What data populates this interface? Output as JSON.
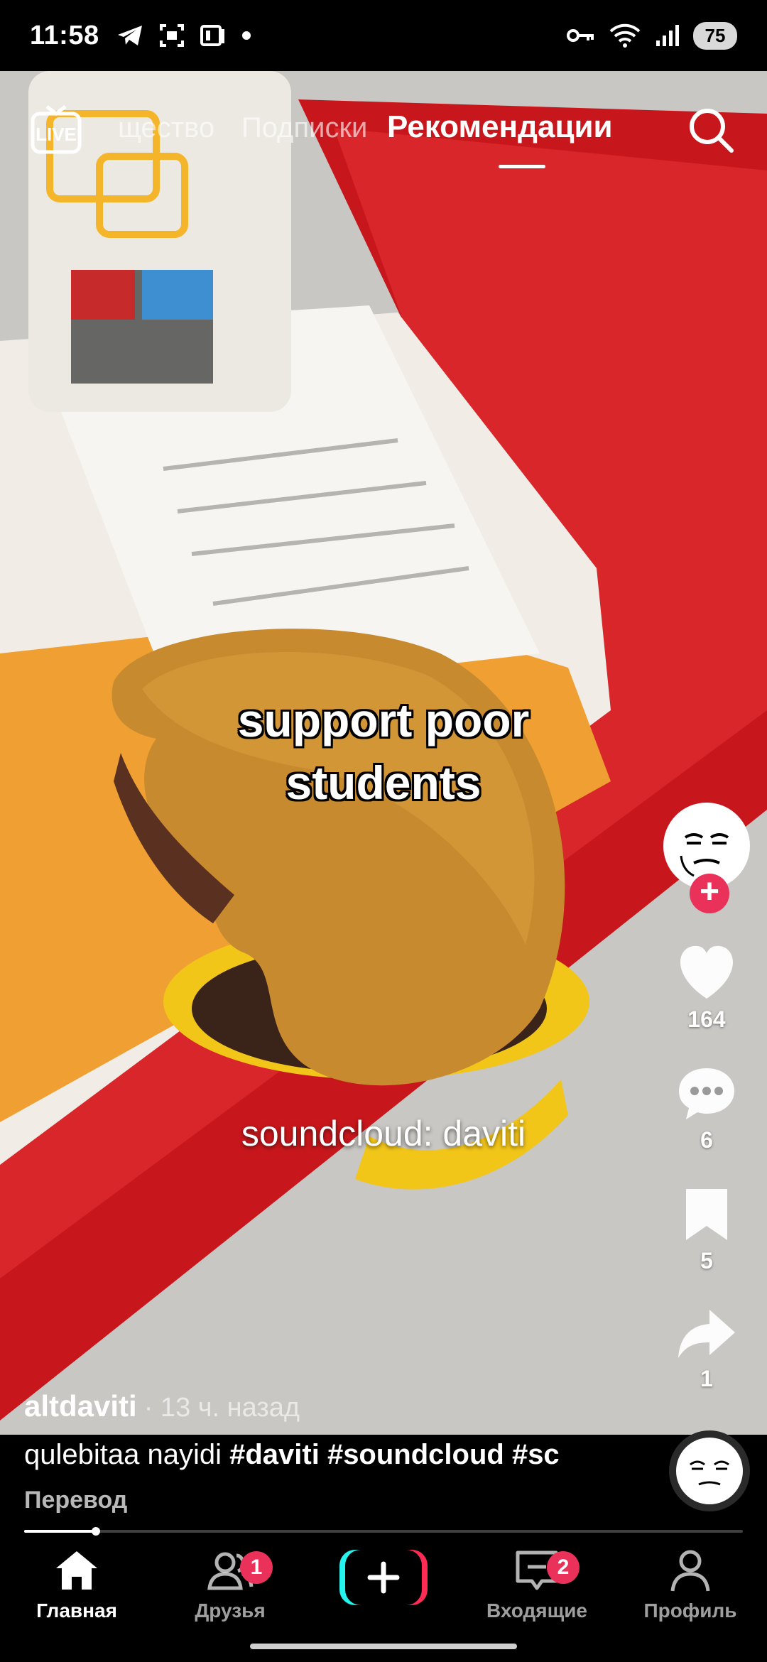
{
  "status_bar": {
    "time": "11:58",
    "battery": "75",
    "icons": [
      "telegram-icon",
      "screenshot-icon",
      "media-icon",
      "dot-icon",
      "key-icon",
      "wifi-icon",
      "signal-icon"
    ]
  },
  "top_nav": {
    "live_label": "LIVE",
    "tabs": [
      {
        "label": "щество",
        "active": false
      },
      {
        "label": "Подписки",
        "active": false
      },
      {
        "label": "Рекомендации",
        "active": true
      }
    ]
  },
  "video": {
    "caption_main_line1": "support poor",
    "caption_main_line2": "students",
    "caption_secondary": "soundcloud: daviti"
  },
  "actions": {
    "likes": "164",
    "comments": "6",
    "saves": "5",
    "shares": "1"
  },
  "post": {
    "author": "altdaviti",
    "time_ago": "· 13 ч. назад",
    "description_text": "qulebitaa nayidi ",
    "description_tags": "#daviti #soundcloud #sc",
    "translate_label": "Перевод",
    "progress": 0.1
  },
  "bottom_nav": {
    "items": [
      {
        "label": "Главная",
        "active": true
      },
      {
        "label": "Друзья",
        "badge": "1"
      },
      {
        "label": "",
        "create": true
      },
      {
        "label": "Входящие",
        "badge": "2"
      },
      {
        "label": "Профиль"
      }
    ]
  },
  "colors": {
    "accent_pink": "#ea3159",
    "create_cyan": "#25f4ee",
    "create_red": "#fe2c55"
  }
}
